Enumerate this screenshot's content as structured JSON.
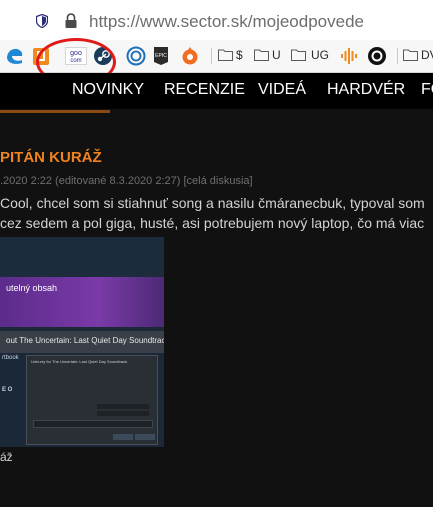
{
  "browser": {
    "url_host": "https://www.sector.sk",
    "url_path": "/mojeodpovede"
  },
  "bookmarks": {
    "labels": [
      "$",
      "U",
      "UG",
      "DV"
    ],
    "icons": [
      "edge-like-icon",
      "bookmark-orange-icon",
      "goo-com-icon",
      "steam-icon",
      "ubisoft-icon",
      "epic-games-icon",
      "origin-icon",
      "folder-icon",
      "audio-wave-icon",
      "ring-logo-icon"
    ],
    "goo_text": [
      "goo",
      "com"
    ],
    "epic_text": "EPIC"
  },
  "nav": {
    "items": [
      "NOVINKY",
      "RECENZIE",
      "VIDEÁ",
      "HARDVÉR",
      "FO"
    ]
  },
  "post": {
    "title": "PITÁN KURÁŽ",
    "meta": ".2020 2:22 (editované 8.3.2020 2:27) [celá diskusia]",
    "line1": "Cool, chcel som si stiahnuť song a nasilu čmáranecbuk, typoval som",
    "line2": "cez sedem a pol giga, husté, asi potrebujem nový laptop, čo má viac",
    "caption": "áž"
  },
  "embedded": {
    "purple_title": "utelný obsah",
    "bar_text": "out The Uncertain: Last Quiet Day Soundtrack",
    "side1": "rtbook",
    "side2": "E O",
    "dialog_title": "Unhurry for The Uncertain: Last Quiet Day Soundtrack"
  },
  "colors": {
    "accent_orange": "#f0831e",
    "annotation_red": "#e01919",
    "site_nav_bg": "#000000",
    "page_bg": "#111111"
  }
}
